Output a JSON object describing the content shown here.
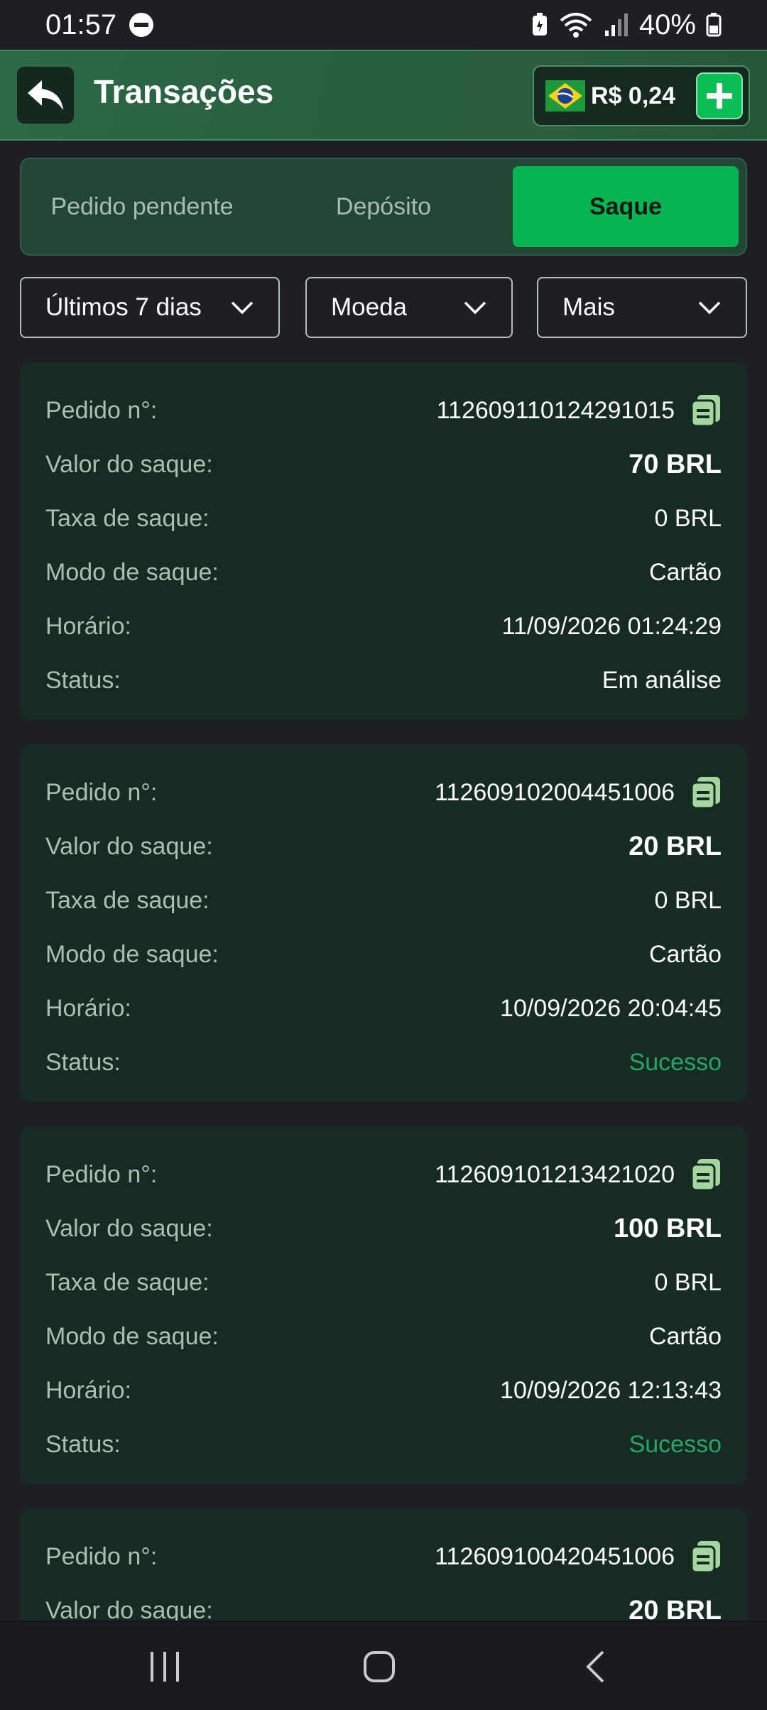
{
  "status_bar": {
    "time": "01:57",
    "battery": "40%"
  },
  "header": {
    "title": "Transações",
    "balance": "R$ 0,24"
  },
  "tabs": [
    {
      "label": "Pedido pendente",
      "active": false
    },
    {
      "label": "Depósito",
      "active": false
    },
    {
      "label": "Saque",
      "active": true
    }
  ],
  "filters": [
    {
      "label": "Últimos 7 dias"
    },
    {
      "label": "Moeda"
    },
    {
      "label": "Mais"
    }
  ],
  "labels": {
    "order": "Pedido n°:",
    "amount": "Valor do saque:",
    "fee": "Taxa de saque:",
    "mode": "Modo de saque:",
    "time": "Horário:",
    "status": "Status:"
  },
  "transactions": [
    {
      "order": "112609110124291015",
      "amount": "70 BRL",
      "fee": "0 BRL",
      "mode": "Cartão",
      "time": "11/09/2026 01:24:29",
      "status": "Em análise"
    },
    {
      "order": "112609102004451006",
      "amount": "20 BRL",
      "fee": "0 BRL",
      "mode": "Cartão",
      "time": "10/09/2026 20:04:45",
      "status": "Sucesso"
    },
    {
      "order": "112609101213421020",
      "amount": "100 BRL",
      "fee": "0 BRL",
      "mode": "Cartão",
      "time": "10/09/2026 12:13:43",
      "status": "Sucesso"
    },
    {
      "order": "112609100420451006",
      "amount": "20 BRL"
    }
  ],
  "colors": {
    "accent": "#07b552",
    "success": "#2aa36a",
    "card": "#162c22",
    "background": "#1e1f24"
  },
  "icons": {
    "back": "back-arrow-icon",
    "copy": "copy-icon",
    "add": "plus-icon",
    "flag": "brazil-flag-icon"
  }
}
